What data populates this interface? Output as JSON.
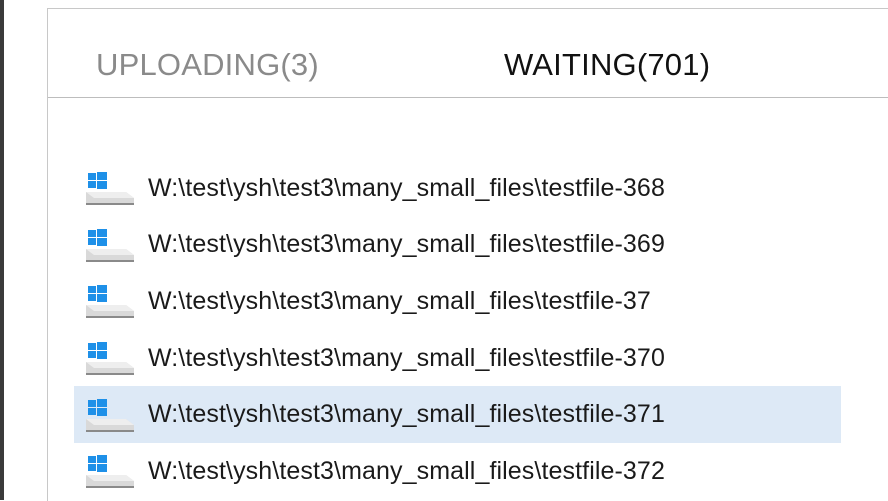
{
  "tabs": [
    {
      "label": "UPLOADING(3)",
      "active": false
    },
    {
      "label": "WAITING(701)",
      "active": true
    }
  ],
  "files": [
    {
      "path": "W:\\test\\ysh\\test3\\many_small_files\\testfile-368",
      "icon": "windows-drive-icon",
      "selected": false
    },
    {
      "path": "W:\\test\\ysh\\test3\\many_small_files\\testfile-369",
      "icon": "windows-drive-icon",
      "selected": false
    },
    {
      "path": "W:\\test\\ysh\\test3\\many_small_files\\testfile-37",
      "icon": "windows-drive-icon",
      "selected": false
    },
    {
      "path": "W:\\test\\ysh\\test3\\many_small_files\\testfile-370",
      "icon": "windows-drive-icon",
      "selected": false
    },
    {
      "path": "W:\\test\\ysh\\test3\\many_small_files\\testfile-371",
      "icon": "windows-drive-icon",
      "selected": true
    },
    {
      "path": "W:\\test\\ysh\\test3\\many_small_files\\testfile-372",
      "icon": "windows-drive-icon",
      "selected": false
    }
  ],
  "colors": {
    "selection": "#dde9f6",
    "windows_logo": "#1e90e8",
    "drive_body": "#d9d9d9",
    "inactive_tab": "#8a8a8a",
    "active_tab": "#111111"
  }
}
